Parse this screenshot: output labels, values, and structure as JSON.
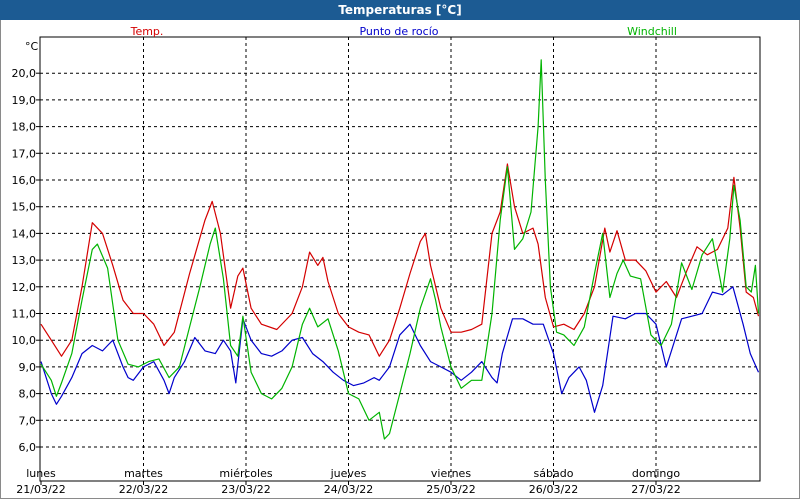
{
  "window": {
    "title": "Temperaturas [°C]"
  },
  "colors": {
    "temp": "#d40000",
    "dew": "#0000cc",
    "windchill": "#00b400",
    "grid": "#000000",
    "title_bg": "#1c5b93"
  },
  "chart_data": {
    "type": "line",
    "title": "Temperaturas [°C]",
    "unit": "°C",
    "ylim": [
      5.5,
      21.0
    ],
    "grid": true,
    "legend_position": "top",
    "yticks": [
      "6,0",
      "7,0",
      "8,0",
      "9,0",
      "10,0",
      "11,0",
      "12,0",
      "13,0",
      "14,0",
      "15,0",
      "16,0",
      "17,0",
      "18,0",
      "19,0",
      "20,0"
    ],
    "days": [
      {
        "weekday": "lunes",
        "date": "21/03/22"
      },
      {
        "weekday": "martes",
        "date": "22/03/22"
      },
      {
        "weekday": "miércoles",
        "date": "23/03/22"
      },
      {
        "weekday": "jueves",
        "date": "24/03/22"
      },
      {
        "weekday": "viernes",
        "date": "25/03/22"
      },
      {
        "weekday": "sábado",
        "date": "26/03/22"
      },
      {
        "weekday": "domingo",
        "date": "27/03/22"
      }
    ],
    "x_unit": "days since 21/03/22 00:00",
    "series": [
      {
        "name": "Temp.",
        "color": "#d40000",
        "points": [
          [
            0.0,
            10.6
          ],
          [
            0.1,
            10.0
          ],
          [
            0.2,
            9.4
          ],
          [
            0.3,
            10.0
          ],
          [
            0.4,
            12.0
          ],
          [
            0.5,
            14.4
          ],
          [
            0.6,
            14.0
          ],
          [
            0.7,
            12.8
          ],
          [
            0.8,
            11.5
          ],
          [
            0.9,
            11.0
          ],
          [
            1.0,
            11.0
          ],
          [
            1.1,
            10.6
          ],
          [
            1.2,
            9.8
          ],
          [
            1.3,
            10.3
          ],
          [
            1.45,
            12.5
          ],
          [
            1.6,
            14.5
          ],
          [
            1.67,
            15.2
          ],
          [
            1.75,
            14.0
          ],
          [
            1.85,
            11.2
          ],
          [
            1.92,
            12.4
          ],
          [
            1.97,
            12.7
          ],
          [
            2.05,
            11.2
          ],
          [
            2.15,
            10.6
          ],
          [
            2.3,
            10.4
          ],
          [
            2.45,
            11.0
          ],
          [
            2.55,
            12.0
          ],
          [
            2.62,
            13.3
          ],
          [
            2.7,
            12.8
          ],
          [
            2.75,
            13.1
          ],
          [
            2.8,
            12.2
          ],
          [
            2.9,
            11.0
          ],
          [
            3.0,
            10.5
          ],
          [
            3.1,
            10.3
          ],
          [
            3.2,
            10.2
          ],
          [
            3.3,
            9.4
          ],
          [
            3.4,
            10.0
          ],
          [
            3.5,
            11.2
          ],
          [
            3.6,
            12.5
          ],
          [
            3.7,
            13.7
          ],
          [
            3.75,
            14.0
          ],
          [
            3.8,
            12.8
          ],
          [
            3.9,
            11.2
          ],
          [
            4.0,
            10.3
          ],
          [
            4.1,
            10.3
          ],
          [
            4.2,
            10.4
          ],
          [
            4.3,
            10.6
          ],
          [
            4.4,
            14.0
          ],
          [
            4.48,
            14.8
          ],
          [
            4.55,
            16.6
          ],
          [
            4.62,
            15.0
          ],
          [
            4.7,
            14.0
          ],
          [
            4.8,
            14.2
          ],
          [
            4.85,
            13.6
          ],
          [
            4.92,
            11.6
          ],
          [
            5.0,
            10.5
          ],
          [
            5.1,
            10.6
          ],
          [
            5.2,
            10.4
          ],
          [
            5.3,
            11.0
          ],
          [
            5.4,
            12.0
          ],
          [
            5.5,
            14.2
          ],
          [
            5.55,
            13.3
          ],
          [
            5.62,
            14.1
          ],
          [
            5.7,
            13.0
          ],
          [
            5.8,
            13.0
          ],
          [
            5.9,
            12.6
          ],
          [
            6.0,
            11.8
          ],
          [
            6.1,
            12.2
          ],
          [
            6.2,
            11.6
          ],
          [
            6.3,
            12.6
          ],
          [
            6.4,
            13.5
          ],
          [
            6.5,
            13.2
          ],
          [
            6.6,
            13.4
          ],
          [
            6.7,
            14.2
          ],
          [
            6.76,
            16.1
          ],
          [
            6.82,
            14.2
          ],
          [
            6.88,
            11.8
          ],
          [
            6.95,
            11.6
          ],
          [
            7.0,
            10.9
          ]
        ]
      },
      {
        "name": "Punto de rocío",
        "color": "#0000cc",
        "points": [
          [
            0.0,
            9.2
          ],
          [
            0.1,
            8.0
          ],
          [
            0.15,
            7.6
          ],
          [
            0.2,
            7.9
          ],
          [
            0.3,
            8.6
          ],
          [
            0.4,
            9.5
          ],
          [
            0.5,
            9.8
          ],
          [
            0.6,
            9.6
          ],
          [
            0.65,
            9.8
          ],
          [
            0.7,
            10.0
          ],
          [
            0.8,
            9.0
          ],
          [
            0.85,
            8.6
          ],
          [
            0.9,
            8.5
          ],
          [
            1.0,
            9.0
          ],
          [
            1.1,
            9.2
          ],
          [
            1.2,
            8.5
          ],
          [
            1.25,
            8.0
          ],
          [
            1.3,
            8.6
          ],
          [
            1.4,
            9.2
          ],
          [
            1.5,
            10.1
          ],
          [
            1.6,
            9.6
          ],
          [
            1.7,
            9.5
          ],
          [
            1.78,
            10.0
          ],
          [
            1.85,
            9.6
          ],
          [
            1.9,
            8.4
          ],
          [
            1.97,
            10.8
          ],
          [
            2.05,
            10.0
          ],
          [
            2.15,
            9.5
          ],
          [
            2.25,
            9.4
          ],
          [
            2.35,
            9.6
          ],
          [
            2.45,
            10.0
          ],
          [
            2.55,
            10.1
          ],
          [
            2.65,
            9.5
          ],
          [
            2.75,
            9.2
          ],
          [
            2.85,
            8.8
          ],
          [
            2.95,
            8.5
          ],
          [
            3.05,
            8.3
          ],
          [
            3.15,
            8.4
          ],
          [
            3.25,
            8.6
          ],
          [
            3.3,
            8.5
          ],
          [
            3.4,
            9.0
          ],
          [
            3.5,
            10.2
          ],
          [
            3.6,
            10.6
          ],
          [
            3.7,
            9.8
          ],
          [
            3.8,
            9.2
          ],
          [
            3.9,
            9.0
          ],
          [
            4.0,
            8.8
          ],
          [
            4.1,
            8.5
          ],
          [
            4.2,
            8.8
          ],
          [
            4.3,
            9.2
          ],
          [
            4.4,
            8.6
          ],
          [
            4.45,
            8.4
          ],
          [
            4.5,
            9.5
          ],
          [
            4.6,
            10.8
          ],
          [
            4.7,
            10.8
          ],
          [
            4.8,
            10.6
          ],
          [
            4.9,
            10.6
          ],
          [
            5.0,
            9.5
          ],
          [
            5.08,
            8.0
          ],
          [
            5.15,
            8.6
          ],
          [
            5.25,
            9.0
          ],
          [
            5.32,
            8.5
          ],
          [
            5.4,
            7.3
          ],
          [
            5.48,
            8.3
          ],
          [
            5.58,
            10.9
          ],
          [
            5.7,
            10.8
          ],
          [
            5.8,
            11.0
          ],
          [
            5.9,
            11.0
          ],
          [
            6.0,
            10.6
          ],
          [
            6.1,
            9.0
          ],
          [
            6.15,
            9.6
          ],
          [
            6.25,
            10.8
          ],
          [
            6.35,
            10.9
          ],
          [
            6.45,
            11.0
          ],
          [
            6.55,
            11.8
          ],
          [
            6.65,
            11.7
          ],
          [
            6.75,
            12.0
          ],
          [
            6.85,
            10.6
          ],
          [
            6.92,
            9.5
          ],
          [
            7.0,
            8.8
          ]
        ]
      },
      {
        "name": "Windchill",
        "color": "#00b400",
        "points": [
          [
            0.0,
            9.1
          ],
          [
            0.1,
            8.5
          ],
          [
            0.15,
            7.9
          ],
          [
            0.2,
            8.4
          ],
          [
            0.3,
            9.5
          ],
          [
            0.4,
            11.5
          ],
          [
            0.5,
            13.4
          ],
          [
            0.55,
            13.6
          ],
          [
            0.65,
            12.7
          ],
          [
            0.75,
            10.0
          ],
          [
            0.85,
            9.1
          ],
          [
            0.95,
            9.0
          ],
          [
            1.05,
            9.2
          ],
          [
            1.15,
            9.3
          ],
          [
            1.25,
            8.6
          ],
          [
            1.35,
            9.0
          ],
          [
            1.45,
            10.5
          ],
          [
            1.55,
            12.0
          ],
          [
            1.65,
            13.6
          ],
          [
            1.7,
            14.2
          ],
          [
            1.78,
            12.3
          ],
          [
            1.85,
            9.8
          ],
          [
            1.92,
            9.4
          ],
          [
            1.97,
            10.9
          ],
          [
            2.05,
            8.8
          ],
          [
            2.15,
            8.0
          ],
          [
            2.25,
            7.8
          ],
          [
            2.35,
            8.2
          ],
          [
            2.45,
            9.0
          ],
          [
            2.55,
            10.6
          ],
          [
            2.62,
            11.2
          ],
          [
            2.7,
            10.5
          ],
          [
            2.8,
            10.8
          ],
          [
            2.9,
            9.6
          ],
          [
            3.0,
            8.0
          ],
          [
            3.1,
            7.8
          ],
          [
            3.2,
            7.0
          ],
          [
            3.3,
            7.3
          ],
          [
            3.35,
            6.3
          ],
          [
            3.4,
            6.5
          ],
          [
            3.5,
            8.0
          ],
          [
            3.6,
            9.5
          ],
          [
            3.7,
            11.2
          ],
          [
            3.8,
            12.3
          ],
          [
            3.85,
            11.5
          ],
          [
            3.9,
            10.5
          ],
          [
            4.0,
            9.0
          ],
          [
            4.1,
            8.2
          ],
          [
            4.2,
            8.5
          ],
          [
            4.3,
            8.5
          ],
          [
            4.4,
            11.0
          ],
          [
            4.48,
            14.5
          ],
          [
            4.55,
            16.5
          ],
          [
            4.62,
            13.4
          ],
          [
            4.7,
            13.8
          ],
          [
            4.78,
            14.8
          ],
          [
            4.85,
            18.0
          ],
          [
            4.88,
            20.5
          ],
          [
            4.92,
            16.0
          ],
          [
            4.97,
            12.0
          ],
          [
            5.03,
            10.3
          ],
          [
            5.1,
            10.2
          ],
          [
            5.2,
            9.8
          ],
          [
            5.3,
            10.5
          ],
          [
            5.4,
            12.5
          ],
          [
            5.48,
            14.0
          ],
          [
            5.55,
            11.6
          ],
          [
            5.62,
            12.5
          ],
          [
            5.68,
            13.0
          ],
          [
            5.75,
            12.4
          ],
          [
            5.85,
            12.3
          ],
          [
            5.95,
            10.2
          ],
          [
            6.05,
            9.8
          ],
          [
            6.15,
            10.6
          ],
          [
            6.25,
            12.9
          ],
          [
            6.35,
            11.9
          ],
          [
            6.45,
            13.2
          ],
          [
            6.55,
            13.8
          ],
          [
            6.65,
            11.8
          ],
          [
            6.72,
            13.8
          ],
          [
            6.76,
            15.8
          ],
          [
            6.82,
            14.5
          ],
          [
            6.88,
            12.0
          ],
          [
            6.93,
            11.8
          ],
          [
            6.97,
            12.8
          ],
          [
            7.0,
            11.0
          ]
        ]
      }
    ]
  }
}
